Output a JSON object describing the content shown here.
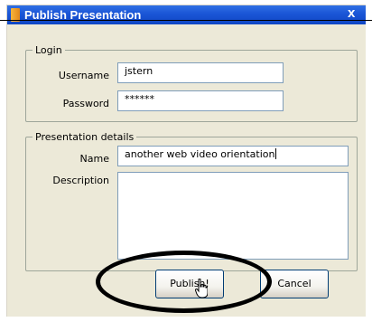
{
  "window": {
    "title": "Publish Presentation",
    "close_glyph": "x"
  },
  "login": {
    "legend": "Login",
    "username_label": "Username",
    "username_value": "jstern",
    "password_label": "Password",
    "password_value": "******"
  },
  "details": {
    "legend": "Presentation details",
    "name_label": "Name",
    "name_value": "another web video orientation",
    "description_label": "Description",
    "description_value": ""
  },
  "buttons": {
    "publish_label": "Publish!",
    "cancel_label": "Cancel"
  },
  "icons": {
    "title_icon": "presentation-icon",
    "close_icon": "close-icon",
    "cursor": "hand-pointer-cursor"
  },
  "colors": {
    "titlebar": "#0f46c4",
    "dialog_bg": "#ece9d8",
    "field_border": "#7f9db9",
    "annotation_ellipse": "#000000"
  }
}
